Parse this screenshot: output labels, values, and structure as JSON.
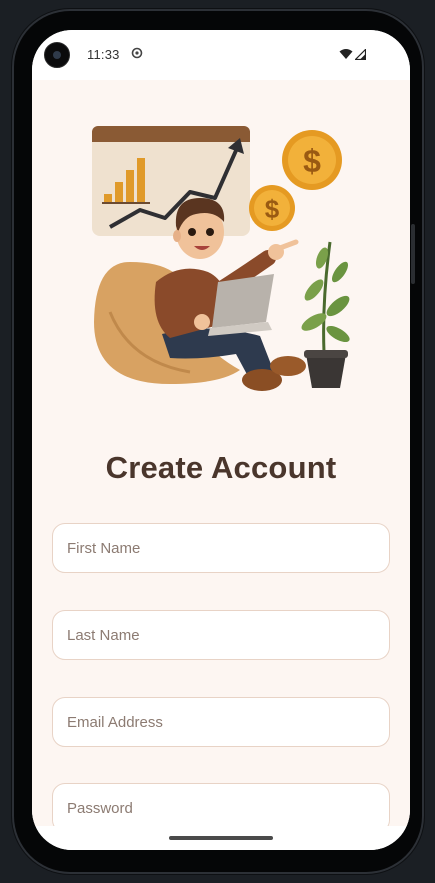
{
  "status_bar": {
    "time": "11:33",
    "icons": [
      "sync-icon",
      "wifi-icon",
      "signal-icon"
    ]
  },
  "hero": {
    "illustration": "man-on-beanbag-with-laptop-growth-chart-coins-plant",
    "coin_symbol": "$"
  },
  "title": "Create Account",
  "form": {
    "first_name": {
      "placeholder": "First Name",
      "value": ""
    },
    "last_name": {
      "placeholder": "Last Name",
      "value": ""
    },
    "email": {
      "placeholder": "Email Address",
      "value": ""
    },
    "password": {
      "placeholder": "Password",
      "value": ""
    }
  },
  "colors": {
    "background": "#fdf6f2",
    "title": "#4a362c",
    "field_border": "#e8d3c6",
    "accent": "#e09a2a"
  }
}
